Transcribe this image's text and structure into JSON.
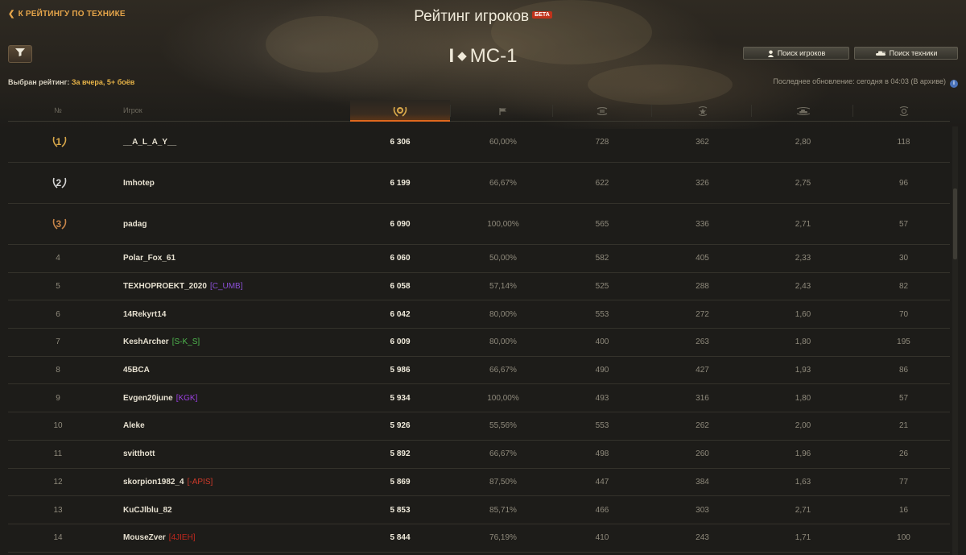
{
  "header": {
    "back_link": "К РЕЙТИНГУ ПО ТЕХНИКЕ",
    "title": "Рейтинг игроков",
    "beta_badge": "БЕТА",
    "tank_tier": "I",
    "tank_name": "МС-1",
    "search_players_label": "Поиск игроков",
    "search_vehicles_label": "Поиск техники"
  },
  "status": {
    "selected_rating_label": "Выбран рейтинг:",
    "selected_rating_value": "За вчера, 5+ боёв",
    "last_update": "Последнее обновление: сегодня в 04:03 (В архиве)"
  },
  "table": {
    "columns": {
      "rank": "№",
      "player": "Игрок"
    },
    "rows": [
      {
        "rank": "1",
        "name": "__A_L_A_Y__",
        "clan": "",
        "clan_color": "",
        "score": "6 306",
        "winrate": "60,00%",
        "battles": "728",
        "xp": "362",
        "kills": "2,80",
        "dmg": "118"
      },
      {
        "rank": "2",
        "name": "Imhotep",
        "clan": "",
        "clan_color": "",
        "score": "6 199",
        "winrate": "66,67%",
        "battles": "622",
        "xp": "326",
        "kills": "2,75",
        "dmg": "96"
      },
      {
        "rank": "3",
        "name": "padag",
        "clan": "",
        "clan_color": "",
        "score": "6 090",
        "winrate": "100,00%",
        "battles": "565",
        "xp": "336",
        "kills": "2,71",
        "dmg": "57"
      },
      {
        "rank": "4",
        "name": "Polar_Fox_61",
        "clan": "",
        "clan_color": "",
        "score": "6 060",
        "winrate": "50,00%",
        "battles": "582",
        "xp": "405",
        "kills": "2,33",
        "dmg": "30"
      },
      {
        "rank": "5",
        "name": "TEXHOPROEKT_2020",
        "clan": "[C_UMB]",
        "clan_color": "#8a4fd6",
        "score": "6 058",
        "winrate": "57,14%",
        "battles": "525",
        "xp": "288",
        "kills": "2,43",
        "dmg": "82"
      },
      {
        "rank": "6",
        "name": "14Rekyrt14",
        "clan": "",
        "clan_color": "",
        "score": "6 042",
        "winrate": "80,00%",
        "battles": "553",
        "xp": "272",
        "kills": "1,60",
        "dmg": "70"
      },
      {
        "rank": "7",
        "name": "KeshArcher",
        "clan": "[S-K_S]",
        "clan_color": "#4fb84f",
        "score": "6 009",
        "winrate": "80,00%",
        "battles": "400",
        "xp": "263",
        "kills": "1,80",
        "dmg": "195"
      },
      {
        "rank": "8",
        "name": "45BCA",
        "clan": "",
        "clan_color": "",
        "score": "5 986",
        "winrate": "66,67%",
        "battles": "490",
        "xp": "427",
        "kills": "1,93",
        "dmg": "86"
      },
      {
        "rank": "9",
        "name": "Evgen20june",
        "clan": "[KGK]",
        "clan_color": "#9a3fe0",
        "score": "5 934",
        "winrate": "100,00%",
        "battles": "493",
        "xp": "316",
        "kills": "1,80",
        "dmg": "57"
      },
      {
        "rank": "10",
        "name": "Aleke",
        "clan": "",
        "clan_color": "",
        "score": "5 926",
        "winrate": "55,56%",
        "battles": "553",
        "xp": "262",
        "kills": "2,00",
        "dmg": "21"
      },
      {
        "rank": "11",
        "name": "svitthott",
        "clan": "",
        "clan_color": "",
        "score": "5 892",
        "winrate": "66,67%",
        "battles": "498",
        "xp": "260",
        "kills": "1,96",
        "dmg": "26"
      },
      {
        "rank": "12",
        "name": "skorpion1982_4",
        "clan": "[-APIS]",
        "clan_color": "#d03a2a",
        "score": "5 869",
        "winrate": "87,50%",
        "battles": "447",
        "xp": "384",
        "kills": "1,63",
        "dmg": "77"
      },
      {
        "rank": "13",
        "name": "KuCJlblu_82",
        "clan": "",
        "clan_color": "",
        "score": "5 853",
        "winrate": "85,71%",
        "battles": "466",
        "xp": "303",
        "kills": "2,71",
        "dmg": "16"
      },
      {
        "rank": "14",
        "name": "MouseZver",
        "clan": "[4JIEH]",
        "clan_color": "#c0281e",
        "score": "5 844",
        "winrate": "76,19%",
        "battles": "410",
        "xp": "243",
        "kills": "1,71",
        "dmg": "100"
      }
    ]
  },
  "colors": {
    "accent": "#e6a54a",
    "sorted_underline": "#e0681e",
    "gold_medal": "#d9a84a",
    "silver_medal": "#d8d8d8",
    "bronze_medal": "#c8864a"
  },
  "icons": {
    "filter": "filter-icon",
    "score": "laurel-score-icon",
    "winrate": "flag-icon",
    "battles": "crossed-swords-icon",
    "xp": "star-icon",
    "kills": "tank-kill-icon",
    "damage": "target-icon"
  }
}
